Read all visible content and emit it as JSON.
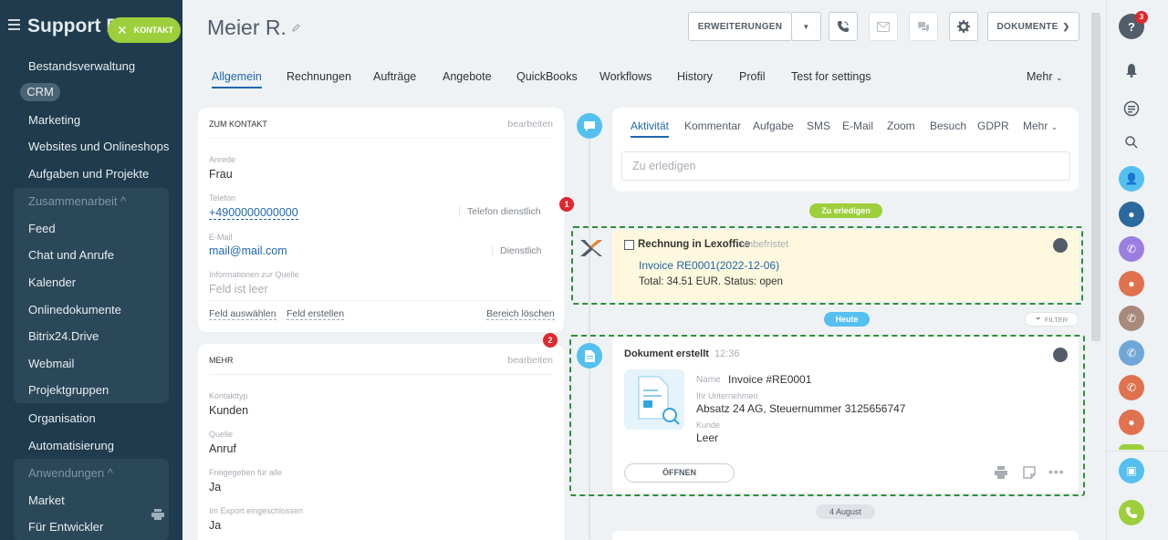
{
  "sidebar": {
    "title": "Support D",
    "kontakt_label": "KONTAKT",
    "items": [
      {
        "label": "Bestandsverwaltung"
      },
      {
        "label": "CRM"
      },
      {
        "label": "Marketing"
      },
      {
        "label": "Websites und Onlineshops"
      },
      {
        "label": "Aufgaben und Projekte"
      },
      {
        "label": "Zusammenarbeit ^"
      },
      {
        "label": "Feed"
      },
      {
        "label": "Chat und Anrufe"
      },
      {
        "label": "Kalender"
      },
      {
        "label": "Onlinedokumente"
      },
      {
        "label": "Bitrix24.Drive"
      },
      {
        "label": "Webmail"
      },
      {
        "label": "Projektgruppen"
      },
      {
        "label": "Organisation"
      },
      {
        "label": "Automatisierung"
      },
      {
        "label": "Anwendungen ^"
      },
      {
        "label": "Market"
      },
      {
        "label": "Für Entwickler"
      }
    ]
  },
  "header": {
    "title": "Meier R.",
    "erweiterungen_label": "ERWEITERUNGEN",
    "dokumente_label": "DOKUMENTE"
  },
  "tabs": [
    "Allgemein",
    "Rechnungen",
    "Aufträge",
    "Angebote",
    "QuickBooks",
    "Workflows",
    "History",
    "Profil",
    "Test for settings",
    "Mehr"
  ],
  "contact_card": {
    "title": "ZUM KONTAKT",
    "edit": "bearbeiten",
    "anrede_label": "Anrede",
    "anrede_value": "Frau",
    "telefon_label": "Telefon",
    "telefon_value": "+4900000000000",
    "telefon_type": "Telefon dienstlich",
    "email_label": "E-Mail",
    "email_value": "mail@mail.com",
    "email_type": "Dienstlich",
    "quelle_info_label": "Informationen zur Quelle",
    "quelle_info_value": "Feld ist leer",
    "action_select": "Feld auswählen",
    "action_create": "Feld erstellen",
    "action_clear": "Bereich löschen"
  },
  "more_card": {
    "title": "MEHR",
    "edit": "bearbeiten",
    "kontakttyp_label": "Kontakttyp",
    "kontakttyp_value": "Kunden",
    "quelle_label": "Quelle",
    "quelle_value": "Anruf",
    "freigegeben_label": "Freigegeben für alle",
    "freigegeben_value": "Ja",
    "export_label": "Im Export eingeschlossen",
    "export_value": "Ja"
  },
  "activity": {
    "tabs": [
      "Aktivität",
      "Kommentar",
      "Aufgabe",
      "SMS",
      "E-Mail",
      "Zoom",
      "Besuch",
      "GDPR",
      "Mehr"
    ],
    "placeholder": "Zu erledigen"
  },
  "timeline": {
    "todo_pill": "Zu erledigen",
    "todo_item": {
      "title": "Rechnung in Lexoffice",
      "status": "Unbefristet",
      "link": "Invoice RE0001(2022-12-06)",
      "detail": "Total: 34.51 EUR. Status: open"
    },
    "today_pill": "Heute",
    "filter_label": "FILTER",
    "doc_item": {
      "title": "Dokument erstellt",
      "time": "12:36",
      "name_label": "Name",
      "name_value": "Invoice #RE0001",
      "company_label": "Ihr Unternehmen",
      "company_value": "Absatz 24 AG, Steuernummer 3125656747",
      "kunde_label": "Kunde",
      "kunde_value": "Leer",
      "open_button": "ÖFFNEN"
    },
    "date_pill": "4 August"
  },
  "markers": {
    "one": "1",
    "two": "2"
  },
  "notifications": {
    "count": "3"
  },
  "colors": {
    "sidebar_bg": "#1f3b4d",
    "accent": "#2067b0",
    "kontakt_green": "#9ccf3b",
    "todo_pill": "#9ccf3b",
    "today_pill": "#55c0f0",
    "marker_red": "#e0282e"
  }
}
